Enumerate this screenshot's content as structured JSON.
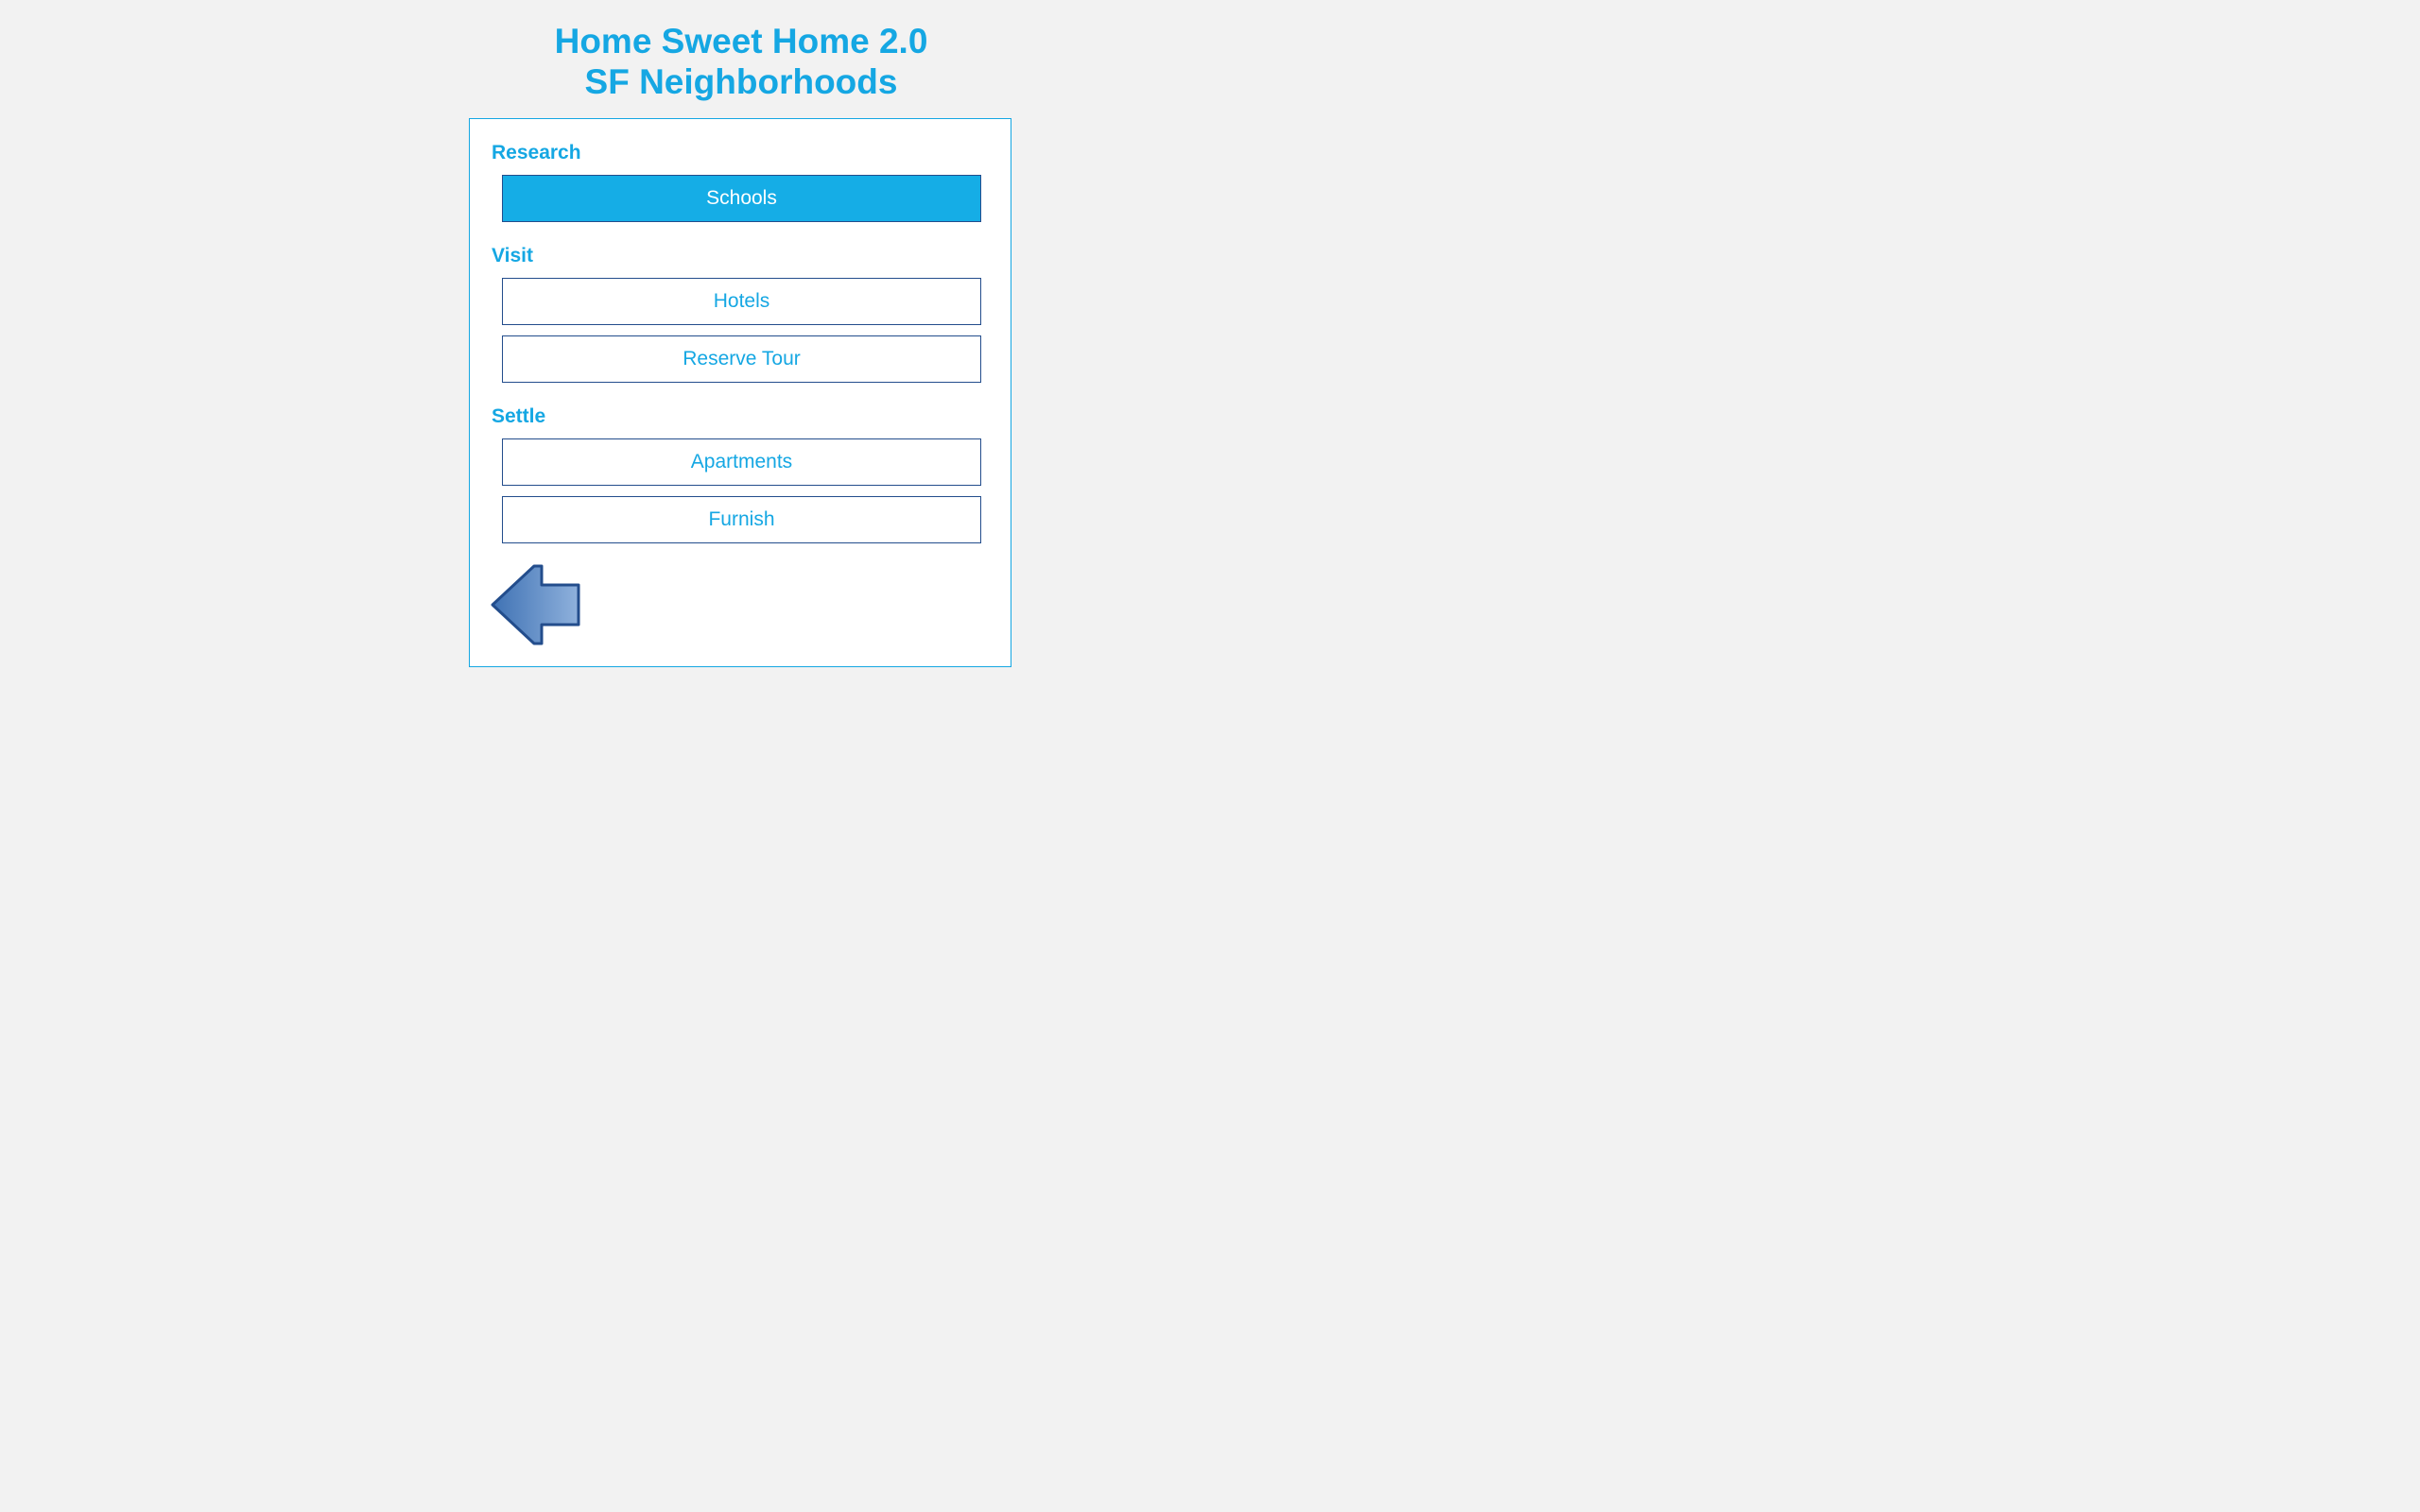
{
  "header": {
    "title_line1": "Home Sweet Home 2.0",
    "title_line2": "SF Neighborhoods"
  },
  "sections": {
    "research": {
      "label": "Research",
      "buttons": [
        "Schools"
      ]
    },
    "visit": {
      "label": "Visit",
      "buttons": [
        "Hotels",
        "Reserve Tour"
      ]
    },
    "settle": {
      "label": "Settle",
      "buttons": [
        "Apartments",
        "Furnish"
      ]
    }
  },
  "selected": "Schools",
  "back_icon": "arrow-left-icon",
  "colors": {
    "accent": "#15a7e3",
    "button_border": "#234d8c",
    "selected_fill": "#15ade6",
    "background": "#f2f2f2",
    "arrow_fill_light": "#8fb1dc",
    "arrow_fill_dark": "#3f72b4"
  }
}
